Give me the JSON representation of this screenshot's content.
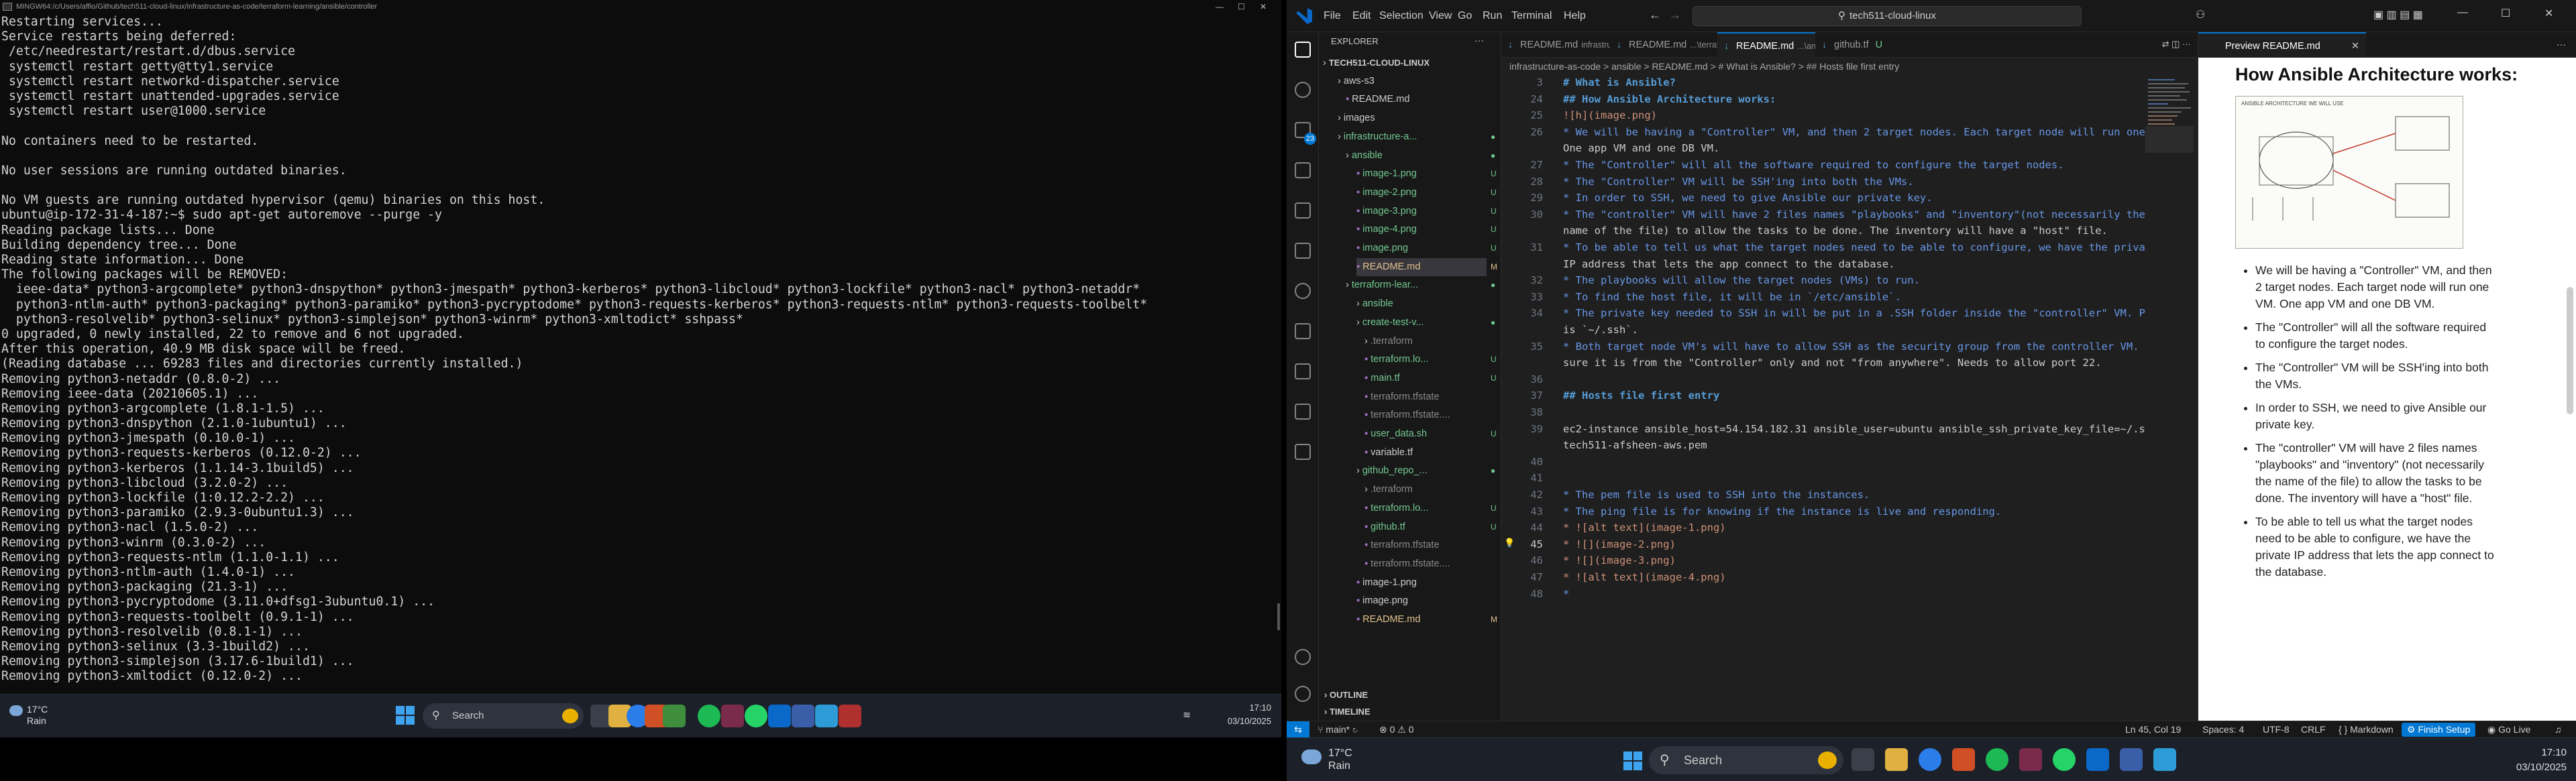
{
  "terminal": {
    "title": "MINGW64:/c/Users/affio/Github/tech511-cloud-linux/infrastructure-as-code/terraform-learning/ansible/controller",
    "lines": [
      "Restarting services...",
      "Service restarts being deferred:",
      " /etc/needrestart/restart.d/dbus.service",
      " systemctl restart getty@tty1.service",
      " systemctl restart networkd-dispatcher.service",
      " systemctl restart unattended-upgrades.service",
      " systemctl restart user@1000.service",
      "",
      "No containers need to be restarted.",
      "",
      "No user sessions are running outdated binaries.",
      "",
      "No VM guests are running outdated hypervisor (qemu) binaries on this host.",
      "ubuntu@ip-172-31-4-187:~$ sudo apt-get autoremove --purge -y",
      "Reading package lists... Done",
      "Building dependency tree... Done",
      "Reading state information... Done",
      "The following packages will be REMOVED:",
      "  ieee-data* python3-argcomplete* python3-dnspython* python3-jmespath* python3-kerberos* python3-libcloud* python3-lockfile* python3-nacl* python3-netaddr*",
      "  python3-ntlm-auth* python3-packaging* python3-paramiko* python3-pycryptodome* python3-requests-kerberos* python3-requests-ntlm* python3-requests-toolbelt*",
      "  python3-resolvelib* python3-selinux* python3-simplejson* python3-winrm* python3-xmltodict* sshpass*",
      "0 upgraded, 0 newly installed, 22 to remove and 6 not upgraded.",
      "After this operation, 40.9 MB disk space will be freed.",
      "(Reading database ... 69283 files and directories currently installed.)",
      "Removing python3-netaddr (0.8.0-2) ...",
      "Removing ieee-data (20210605.1) ...",
      "Removing python3-argcomplete (1.8.1-1.5) ...",
      "Removing python3-dnspython (2.1.0-1ubuntu1) ...",
      "Removing python3-jmespath (0.10.0-1) ...",
      "Removing python3-requests-kerberos (0.12.0-2) ...",
      "Removing python3-kerberos (1.1.14-3.1build5) ...",
      "Removing python3-libcloud (3.2.0-2) ...",
      "Removing python3-lockfile (1:0.12.2-2.2) ...",
      "Removing python3-paramiko (2.9.3-0ubuntu1.3) ...",
      "Removing python3-nacl (1.5.0-2) ...",
      "Removing python3-winrm (0.3.0-2) ...",
      "Removing python3-requests-ntlm (1.1.0-1.1) ...",
      "Removing python3-ntlm-auth (1.4.0-1) ...",
      "Removing python3-packaging (21.3-1) ...",
      "Removing python3-pycryptodome (3.11.0+dfsg1-3ubuntu0.1) ...",
      "Removing python3-requests-toolbelt (0.9.1-1) ...",
      "Removing python3-resolvelib (0.8.1-1) ...",
      "Removing python3-selinux (3.3-1build2) ...",
      "Removing python3-simplejson (3.17.6-1build1) ...",
      "Removing python3-xmltodict (0.12.0-2) ..."
    ]
  },
  "taskbar_left": {
    "weather_temp": "17°C",
    "weather_desc": "Rain",
    "search_placeholder": "Search",
    "time": "17:10",
    "date": "03/10/2025"
  },
  "vscode": {
    "menu": [
      "File",
      "Edit",
      "Selection",
      "View",
      "Go",
      "Run",
      "Terminal",
      "Help"
    ],
    "command_center": "tech511-cloud-linux",
    "explorer_title": "EXPLORER",
    "tree": [
      {
        "label": "TECH511-CLOUD-LINUX",
        "badge": "",
        "color": "#cccccc"
      },
      {
        "label": "aws-s3",
        "badge": "",
        "color": "#cccccc"
      },
      {
        "label": "README.md",
        "badge": "",
        "color": "#cccccc"
      },
      {
        "label": "images",
        "badge": "",
        "color": "#cccccc"
      },
      {
        "label": "infrastructure-a...",
        "badge": "●",
        "color": "#73c991"
      },
      {
        "label": "ansible",
        "badge": "●",
        "color": "#73c991"
      },
      {
        "label": "image-1.png",
        "badge": "U",
        "color": "#73c991"
      },
      {
        "label": "image-2.png",
        "badge": "U",
        "color": "#73c991"
      },
      {
        "label": "image-3.png",
        "badge": "U",
        "color": "#73c991"
      },
      {
        "label": "image-4.png",
        "badge": "U",
        "color": "#73c991"
      },
      {
        "label": "image.png",
        "badge": "U",
        "color": "#73c991"
      },
      {
        "label": "README.md",
        "badge": "M",
        "color": "#e2c08d"
      },
      {
        "label": "terraform-lear...",
        "badge": "●",
        "color": "#73c991"
      },
      {
        "label": "ansible",
        "badge": "",
        "color": "#73c991"
      },
      {
        "label": "create-test-v...",
        "badge": "●",
        "color": "#73c991"
      },
      {
        "label": ".terraform",
        "badge": "",
        "color": "#8b8b8b"
      },
      {
        "label": "terraform.lo...",
        "badge": "U",
        "color": "#73c991"
      },
      {
        "label": "main.tf",
        "badge": "U",
        "color": "#73c991"
      },
      {
        "label": "terraform.tfstate",
        "badge": "",
        "color": "#8b8b8b"
      },
      {
        "label": "terraform.tfstate....",
        "badge": "",
        "color": "#8b8b8b"
      },
      {
        "label": "user_data.sh",
        "badge": "U",
        "color": "#73c991"
      },
      {
        "label": "variable.tf",
        "badge": "",
        "color": "#cccccc"
      },
      {
        "label": "github_repo_...",
        "badge": "●",
        "color": "#73c991"
      },
      {
        "label": ".terraform",
        "badge": "",
        "color": "#8b8b8b"
      },
      {
        "label": "terraform.lo...",
        "badge": "U",
        "color": "#73c991"
      },
      {
        "label": "github.tf",
        "badge": "U",
        "color": "#73c991"
      },
      {
        "label": "terraform.tfstate",
        "badge": "",
        "color": "#8b8b8b"
      },
      {
        "label": "terraform.tfstate....",
        "badge": "",
        "color": "#8b8b8b"
      },
      {
        "label": "image-1.png",
        "badge": "",
        "color": "#cccccc"
      },
      {
        "label": "image.png",
        "badge": "",
        "color": "#cccccc"
      },
      {
        "label": "README.md",
        "badge": "M",
        "color": "#e2c08d"
      }
    ],
    "outline_label": "OUTLINE",
    "timeline_label": "TIMELINE",
    "tabs": [
      {
        "label": "README.md",
        "desc": "infrastructure-as-code",
        "badge": "M"
      },
      {
        "label": "README.md",
        "desc": "...\\terraform-learning",
        "badge": "M"
      },
      {
        "label": "README.md",
        "desc": "...\\ansible",
        "badge": "U"
      },
      {
        "label": "github.tf",
        "desc": "",
        "badge": "U"
      }
    ],
    "preview_tab": "Preview README.md",
    "breadcrumb": "infrastructure-as-code  >  ansible  >  README.md  >  # What is Ansible?  >  ## Hosts file first entry",
    "code_lines": [
      {
        "n": "3",
        "t": "# What is Ansible?",
        "k": "hd"
      },
      {
        "n": "24",
        "t": "## How Ansible Architecture works:",
        "k": "hd"
      },
      {
        "n": "25",
        "t": "![h](image.png)",
        "k": "lk"
      },
      {
        "n": "26",
        "t": "* We will be having a \"Controller\" VM, and then 2 target nodes. Each target node will run one VM.",
        "k": "bu"
      },
      {
        "n": "",
        "t": "One app VM and one DB VM.",
        "k": ""
      },
      {
        "n": "27",
        "t": "* The \"Controller\" will all the software required to configure the target nodes.",
        "k": "bu"
      },
      {
        "n": "28",
        "t": "* The \"Controller\" VM will be SSH'ing into both the VMs.",
        "k": "bu"
      },
      {
        "n": "29",
        "t": "* In order to SSH, we need to give Ansible our private key.",
        "k": "bu"
      },
      {
        "n": "30",
        "t": "* The \"controller\" VM will have 2 files names \"playbooks\" and \"inventory\"(not necessarily the",
        "k": "bu"
      },
      {
        "n": "",
        "t": "name of the file) to allow the tasks to be done. The inventory will have a \"host\" file.",
        "k": ""
      },
      {
        "n": "31",
        "t": "* To be able to tell us what the target nodes need to be able to configure, we have the private",
        "k": "bu"
      },
      {
        "n": "",
        "t": "IP address that lets the app connect to the database.",
        "k": ""
      },
      {
        "n": "32",
        "t": "* The playbooks will allow the target nodes (VMs) to run.",
        "k": "bu"
      },
      {
        "n": "33",
        "t": "* To find the host file, it will be in `/etc/ansible`.",
        "k": "bu"
      },
      {
        "n": "34",
        "t": "* The private key needed to SSH in will be put in a .SSH folder inside the \"controller\" VM. Path",
        "k": "bu"
      },
      {
        "n": "",
        "t": "is `~/.ssh`.",
        "k": ""
      },
      {
        "n": "35",
        "t": "* Both target node VM's will have to allow SSH as the security group from the controller VM. Make",
        "k": "bu"
      },
      {
        "n": "",
        "t": "sure it is from the \"Controller\" only and not \"from anywhere\". Needs to allow port 22.",
        "k": ""
      },
      {
        "n": "36",
        "t": "",
        "k": ""
      },
      {
        "n": "37",
        "t": "## Hosts file first entry",
        "k": "hd"
      },
      {
        "n": "38",
        "t": "",
        "k": ""
      },
      {
        "n": "39",
        "t": "ec2-instance ansible_host=54.154.182.31 ansible_user=ubuntu ansible_ssh_private_key_file=~/.ssh/",
        "k": ""
      },
      {
        "n": "",
        "t": "tech511-afsheen-aws.pem",
        "k": ""
      },
      {
        "n": "40",
        "t": "",
        "k": ""
      },
      {
        "n": "41",
        "t": "",
        "k": ""
      },
      {
        "n": "42",
        "t": "* The pem file is used to SSH into the instances.",
        "k": "bu"
      },
      {
        "n": "43",
        "t": "* The ping file is for knowing if the instance is live and responding.",
        "k": "bu"
      },
      {
        "n": "44",
        "t": "* ![alt text](image-1.png)",
        "k": "lk"
      },
      {
        "n": "45",
        "t": "* ![](image-2.png)",
        "k": "lk"
      },
      {
        "n": "46",
        "t": "* ![](image-3.png)",
        "k": "lk"
      },
      {
        "n": "47",
        "t": "* ![alt text](image-4.png)",
        "k": "lk"
      },
      {
        "n": "48",
        "t": "*",
        "k": "bu"
      }
    ],
    "preview": {
      "heading": "How Ansible Architecture works:",
      "image_caption": "ANSIBLE ARCHITECTURE WE WILL USE",
      "bullets": [
        "We will be having a \"Controller\" VM, and then 2 target nodes. Each target node will run one VM. One app VM and one DB VM.",
        "The \"Controller\" will all the software required to configure the target nodes.",
        "The \"Controller\" VM will be SSH'ing into both the VMs.",
        "In order to SSH, we need to give Ansible our private key.",
        "The \"controller\" VM will have 2 files names \"playbooks\" and \"inventory\" (not necessarily the name of the file) to allow the tasks to be done. The inventory will have a \"host\" file.",
        "To be able to tell us what the target nodes need to be able to configure, we have the private IP address that lets the app connect to the database."
      ]
    },
    "status": {
      "branch": "main*",
      "errors": "0",
      "warnings": "0",
      "position": "Ln 45, Col 19",
      "spaces": "Spaces: 4",
      "encoding": "UTF-8",
      "eol": "CRLF",
      "language": "Markdown",
      "finish_setup": "Finish Setup",
      "golive": "Go Live"
    }
  },
  "taskbar_right": {
    "weather_temp": "17°C",
    "weather_desc": "Rain",
    "search_placeholder": "Search",
    "time": "17:10",
    "date": "03/10/2025"
  },
  "colors": {
    "vscode_accent": "#0078d4",
    "git_untracked": "#73c991",
    "git_modified": "#e2c08d"
  }
}
